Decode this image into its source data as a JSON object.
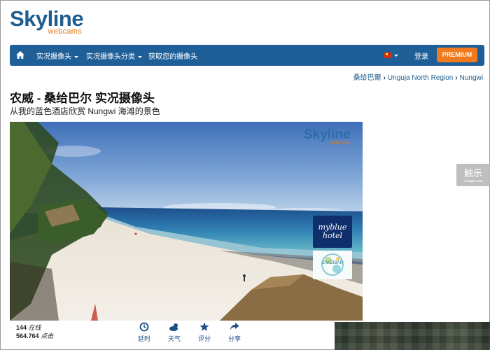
{
  "logo": {
    "main": "Skyline",
    "sub": "webcams"
  },
  "nav": {
    "items": [
      {
        "label": "实况摄像头",
        "has_caret": true
      },
      {
        "label": "实况摄像头分类",
        "has_caret": true
      },
      {
        "label": "获取您的摄像头",
        "has_caret": false
      }
    ],
    "login": "登录",
    "premium": "PREMIUM",
    "home_icon": "home-icon",
    "flag": "china-flag-icon"
  },
  "breadcrumb": [
    "桑给巴爾",
    "Unguja North Region",
    "Nungwi"
  ],
  "page": {
    "title": "农威 - 桑给巴尔 实况摄像头",
    "subtitle": "从我的蓝色酒店欣赏 Nungwi 海滩的景色"
  },
  "video": {
    "watermark_main": "Skyline",
    "watermark_sub": "webcams",
    "ad1": "myblue hotel",
    "ad2": "ZANZIBAR"
  },
  "stats": {
    "online_count": "144",
    "online_label": "在线",
    "views_count": "564.764",
    "views_label": "点击"
  },
  "controls": [
    {
      "label": "延时",
      "icon": "timelapse-icon"
    },
    {
      "label": "天气",
      "icon": "weather-icon"
    },
    {
      "label": "评分",
      "icon": "star-icon"
    },
    {
      "label": "分享",
      "icon": "share-icon"
    }
  ],
  "side_watermark": {
    "main": "触乐",
    "sub": "chuapp.com"
  },
  "colors": {
    "nav_bg": "#1f5f98",
    "premium_bg": "#f07a1d",
    "brand_blue": "#1d5d8f",
    "brand_orange": "#e07b20"
  }
}
